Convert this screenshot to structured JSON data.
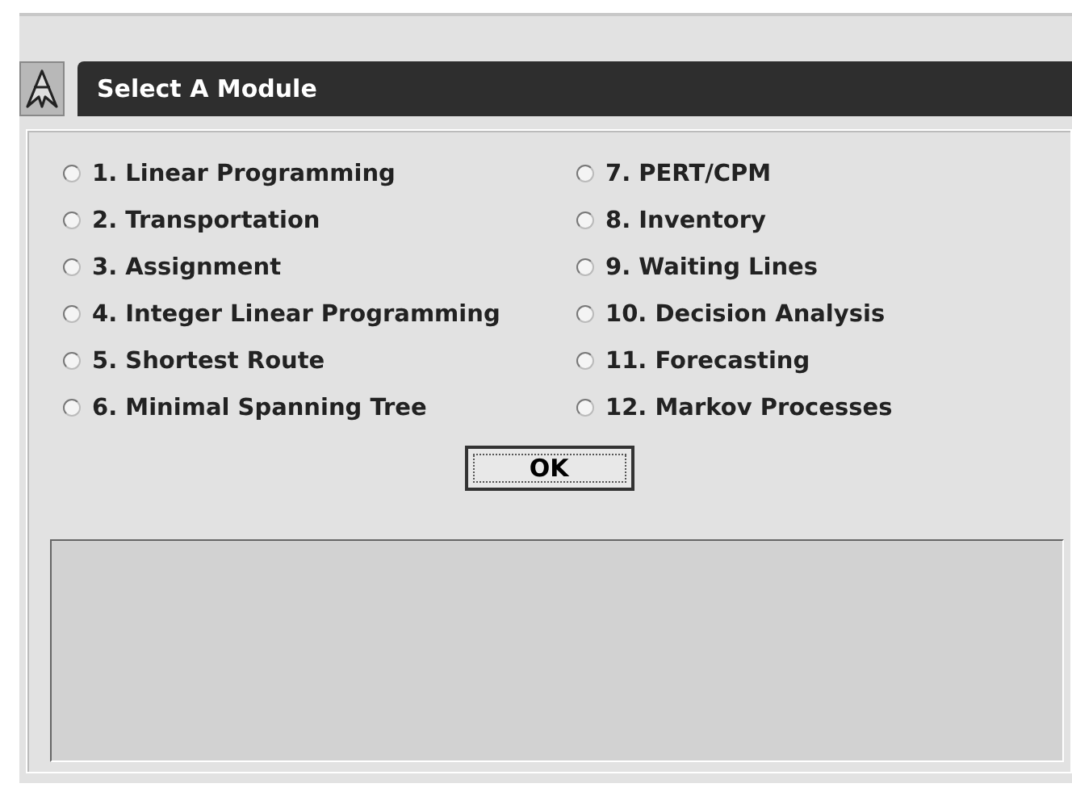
{
  "window": {
    "title": "Select A Module"
  },
  "modules": [
    {
      "label": "1. Linear Programming",
      "selected": false
    },
    {
      "label": "2. Transportation",
      "selected": false
    },
    {
      "label": "3. Assignment",
      "selected": false
    },
    {
      "label": "4. Integer Linear Programming",
      "selected": false
    },
    {
      "label": "5. Shortest Route",
      "selected": false
    },
    {
      "label": "6. Minimal Spanning Tree",
      "selected": false
    },
    {
      "label": "7. PERT/CPM",
      "selected": false
    },
    {
      "label": "8. Inventory",
      "selected": false
    },
    {
      "label": "9. Waiting Lines",
      "selected": false
    },
    {
      "label": "10. Decision Analysis",
      "selected": false
    },
    {
      "label": "11. Forecasting",
      "selected": false
    },
    {
      "label": "12. Markov Processes",
      "selected": false
    }
  ],
  "buttons": [
    "OK"
  ]
}
